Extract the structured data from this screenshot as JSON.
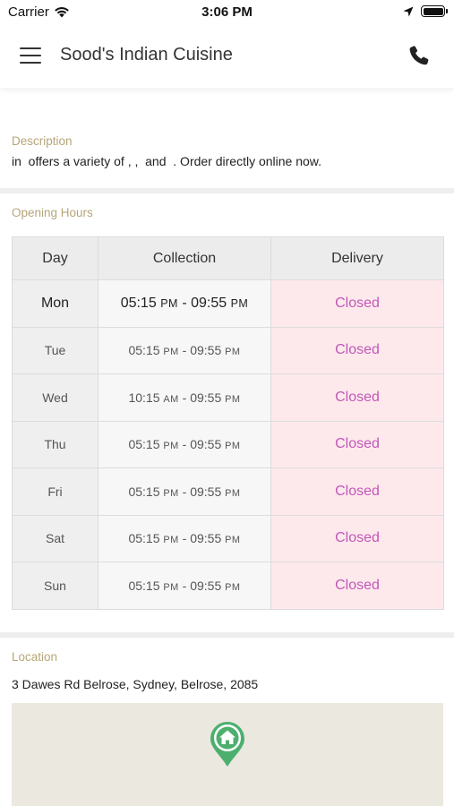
{
  "status_bar": {
    "carrier": "Carrier",
    "time": "3:06 PM",
    "icons": [
      "wifi-icon",
      "location-arrow-icon",
      "battery-icon"
    ]
  },
  "header": {
    "title": "Sood's Indian Cuisine",
    "icons": [
      "hamburger-menu-icon",
      "phone-icon"
    ]
  },
  "description": {
    "label": "Description",
    "text": "in  offers a variety of , ,  and  . Order directly online now."
  },
  "opening_hours": {
    "label": "Opening Hours",
    "columns": [
      "Day",
      "Collection",
      "Delivery"
    ],
    "rows": [
      {
        "day": "Mon",
        "from": "05:15",
        "from_ampm": "PM",
        "sep": " - ",
        "to": "09:55",
        "to_ampm": "PM",
        "delivery": "Closed"
      },
      {
        "day": "Tue",
        "from": "05:15",
        "from_ampm": "PM",
        "sep": " - ",
        "to": "09:55",
        "to_ampm": "PM",
        "delivery": "Closed"
      },
      {
        "day": "Wed",
        "from": "10:15",
        "from_ampm": "AM",
        "sep": " - ",
        "to": "09:55",
        "to_ampm": "PM",
        "delivery": "Closed"
      },
      {
        "day": "Thu",
        "from": "05:15",
        "from_ampm": "PM",
        "sep": " - ",
        "to": "09:55",
        "to_ampm": "PM",
        "delivery": "Closed"
      },
      {
        "day": "Fri",
        "from": "05:15",
        "from_ampm": "PM",
        "sep": " - ",
        "to": "09:55",
        "to_ampm": "PM",
        "delivery": "Closed"
      },
      {
        "day": "Sat",
        "from": "05:15",
        "from_ampm": "PM",
        "sep": " - ",
        "to": "09:55",
        "to_ampm": "PM",
        "delivery": "Closed"
      },
      {
        "day": "Sun",
        "from": "05:15",
        "from_ampm": "PM",
        "sep": " - ",
        "to": "09:55",
        "to_ampm": "PM",
        "delivery": "Closed"
      }
    ]
  },
  "location": {
    "label": "Location",
    "address": "3 Dawes Rd Belrose, Sydney, Belrose, 2085",
    "map_icon": "home-map-pin-icon"
  },
  "colors": {
    "label_gold": "#b5a679",
    "closed_text": "#c257b8",
    "closed_bg": "#fde9ec",
    "pin_green": "#4caf6e",
    "map_bg": "#ebe8e0"
  }
}
